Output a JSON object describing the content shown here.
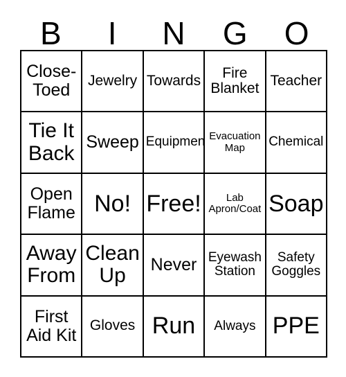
{
  "card": {
    "title": "BINGO",
    "header_letters": [
      "B",
      "I",
      "N",
      "G",
      "O"
    ],
    "rows": [
      [
        {
          "text": "Close-\nToed",
          "size": "md"
        },
        {
          "text": "Jewelry",
          "size": "sm"
        },
        {
          "text": "Towards",
          "size": "sm"
        },
        {
          "text": "Fire\nBlanket",
          "size": "sm"
        },
        {
          "text": "Teacher",
          "size": "sm"
        }
      ],
      [
        {
          "text": "Tie It\nBack",
          "size": "lg"
        },
        {
          "text": "Sweep",
          "size": "md"
        },
        {
          "text": "Equipment",
          "size": "xs"
        },
        {
          "text": "Evacuation\nMap",
          "size": "xxs"
        },
        {
          "text": "Chemical",
          "size": "xs"
        }
      ],
      [
        {
          "text": "Open\nFlame",
          "size": "md"
        },
        {
          "text": "No!",
          "size": "xl"
        },
        {
          "text": "Free!",
          "size": "xl"
        },
        {
          "text": "Lab\nApron/Coat",
          "size": "xxs"
        },
        {
          "text": "Soap",
          "size": "xl"
        }
      ],
      [
        {
          "text": "Away\nFrom",
          "size": "lg"
        },
        {
          "text": "Clean\nUp",
          "size": "lg"
        },
        {
          "text": "Never",
          "size": "md"
        },
        {
          "text": "Eyewash\nStation",
          "size": "xs"
        },
        {
          "text": "Safety\nGoggles",
          "size": "xs"
        }
      ],
      [
        {
          "text": "First\nAid Kit",
          "size": "md"
        },
        {
          "text": "Gloves",
          "size": "sm"
        },
        {
          "text": "Run",
          "size": "xl"
        },
        {
          "text": "Always",
          "size": "xs"
        },
        {
          "text": "PPE",
          "size": "xl"
        }
      ]
    ],
    "free_space_label": "Free!",
    "colors": {
      "background": "#ffffff",
      "text": "#000000",
      "grid_line": "#000000"
    }
  }
}
